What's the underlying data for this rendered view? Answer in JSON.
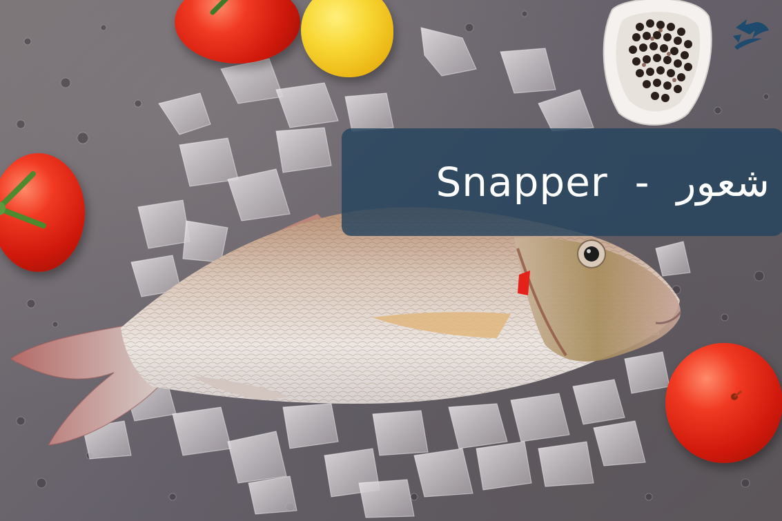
{
  "caption": {
    "text": "Snapper  -  شعور",
    "color": "#ffffff",
    "background": "rgba(38, 68, 94, 0.82)"
  },
  "scene": {
    "background_color": "#6f6a6d",
    "subject": "fish-on-ice",
    "props": [
      "tomato",
      "tomato",
      "tomato",
      "lemon",
      "pepper-bowl"
    ]
  },
  "colors": {
    "tomato": "#d0190c",
    "lemon": "#f8d632",
    "fish_body": "#e9e1dc",
    "fish_back": "#b88e72",
    "ice": "#c9c4c7",
    "logo": "#1d4a6d"
  }
}
